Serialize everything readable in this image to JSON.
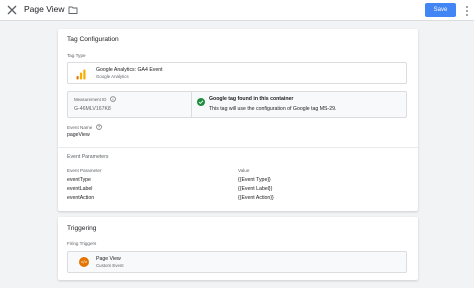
{
  "header": {
    "title": "Page View",
    "save_label": "Save"
  },
  "config": {
    "section_title": "Tag Configuration",
    "tag_type_label": "Tag Type",
    "tag_type": {
      "name": "Google Analytics: GA4 Event",
      "subtitle": "Google Analytics"
    },
    "measurement_label": "Measurement ID",
    "measurement_id": "G-46MLV167K8",
    "found_title": "Google tag found in this container",
    "found_detail": "This tag will use the configuration of Google tag MS-29.",
    "event_name_label": "Event Name",
    "event_name": "pageView",
    "params_title": "Event Parameters",
    "param_col_header": "Event Parameter",
    "value_col_header": "Value",
    "params": [
      {
        "name": "eventType",
        "value": "{{Event Type}}"
      },
      {
        "name": "eventLabel",
        "value": "{{Event Label}}"
      },
      {
        "name": "eventAction",
        "value": "{{Event Action}}"
      }
    ]
  },
  "triggering": {
    "section_title": "Triggering",
    "firing_label": "Firing Triggers",
    "trigger": {
      "name": "Page View",
      "type": "Custom Event"
    }
  },
  "colors": {
    "accent": "#4285f4",
    "success": "#1e8e3e",
    "ga_orange": "#f9ab00",
    "trigger_orange": "#e37400"
  },
  "icons": [
    "close-icon",
    "folder-icon",
    "more-vert-icon",
    "analytics-icon",
    "info-icon",
    "check-circle-icon",
    "help-icon",
    "custom-event-icon"
  ]
}
